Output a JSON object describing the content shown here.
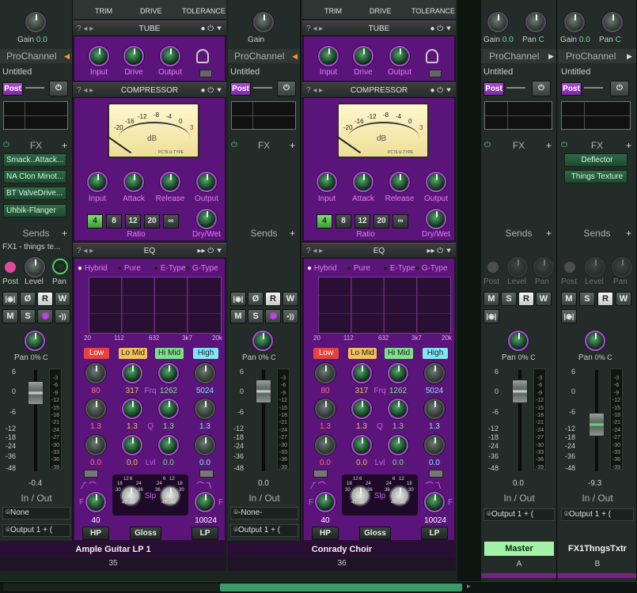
{
  "strip1": {
    "gain_label": "Gain",
    "gain_value": "0.0",
    "prochannel_label": "ProChannel",
    "preset": "Untitled",
    "post_label": "Post",
    "fx_label": "FX",
    "fx_slots": [
      "Smack..Attack...",
      "NA Clon Minot...",
      "BT ValveDrive...",
      "Uhbik-Flanger"
    ],
    "sends_label": "Sends",
    "send_name": "FX1 - things te...",
    "send_post": "Post",
    "send_level": "Level",
    "send_pan": "Pan",
    "pan_label": "Pan",
    "pan_value": "0% C",
    "scale": [
      "6",
      "0",
      "-6",
      "-12",
      "-18",
      "-24",
      "-36",
      "-48"
    ],
    "meter_scale": [
      "-3",
      "-6",
      "-9",
      "-12",
      "-15",
      "-18",
      "-21",
      "-24",
      "-27",
      "-30",
      "-33",
      "-36",
      "-39"
    ],
    "volume": "-0.4",
    "inout_label": "In / Out",
    "input": "None",
    "output": "Output 1 + (",
    "name": "Ample Guitar LP 1",
    "number": "35"
  },
  "pc1": {
    "top_labels": [
      "TRIM",
      "DRIVE",
      "TOLERANCE"
    ],
    "tube_title": "TUBE",
    "tube_knobs": [
      "Input",
      "Drive",
      "Output"
    ],
    "comp_title": "COMPRESSOR",
    "vu_unit": "dB",
    "vu_brand": "PC76 U-TYPE",
    "vu_scale": [
      "-20",
      "-16",
      "-12",
      "-8",
      "-4",
      "0",
      "3"
    ],
    "comp_knobs": [
      "Input",
      "Attack",
      "Release",
      "Output"
    ],
    "ratios": [
      "4",
      "8",
      "12",
      "20",
      "∞"
    ],
    "ratio_label": "Ratio",
    "drywet_label": "Dry/Wet",
    "eq_title": "EQ",
    "eq_modes": [
      "Hybrid",
      "Pure",
      "E-Type",
      "G-Type"
    ],
    "eq_freqs": [
      "20",
      "112",
      "632",
      "3k7",
      "20k"
    ],
    "bands": [
      "Low",
      "Lo Mid",
      "Hi Mid",
      "High"
    ],
    "freq_values": [
      "80",
      "317",
      "1262",
      "5024"
    ],
    "freq_label": "Frq",
    "q_values": [
      "1.3",
      "1.3",
      "1.3",
      "1.3"
    ],
    "q_label": "Q",
    "lvl_values": [
      "0.0",
      "0.0",
      "0.0",
      "0.0"
    ],
    "lvl_label": "Lvl",
    "slp_label": "Slp",
    "slp_scale": [
      "12",
      "6",
      "6",
      "12",
      "18",
      "24",
      "24",
      "18",
      "30",
      "36",
      "36",
      "30",
      "42",
      "48",
      "48",
      "42"
    ],
    "hp_value": "40",
    "lp_value": "10024",
    "f_label": "F",
    "hp_label": "HP",
    "gloss_label": "Gloss",
    "lp_label": "LP"
  },
  "strip2": {
    "gain_label": "Gain",
    "prochannel_label": "ProChannel",
    "preset": "Untitled",
    "post_label": "Post",
    "fx_label": "FX",
    "sends_label": "Sends",
    "pan_label": "Pan",
    "pan_value": "0% C",
    "volume": "0.0",
    "inout_label": "In / Out",
    "input": "-None-",
    "output": "Output 1 + (",
    "name": "Conrady Choir",
    "number": "36"
  },
  "strip3": {
    "gain_label": "Gain",
    "gain_value": "0.0",
    "pan_top": "Pan",
    "pan_top_value": "C",
    "prochannel_label": "ProChannel",
    "preset": "Untitled",
    "post_label": "Post",
    "fx_label": "FX",
    "sends_label": "Sends",
    "send_post": "Post",
    "send_level": "Level",
    "send_pan": "Pan",
    "pan_label": "Pan",
    "pan_value": "0% C",
    "volume": "0.0",
    "inout_label": "In / Out",
    "output": "Output 1 + (",
    "name": "Master",
    "number": "A"
  },
  "strip4": {
    "gain_label": "Gain",
    "gain_value": "0.0",
    "pan_top": "Pan",
    "pan_top_value": "C",
    "prochannel_label": "ProChannel",
    "preset": "Untitled",
    "post_label": "Post",
    "fx_label": "FX",
    "fx_slots": [
      "Deflector",
      "Things Texture"
    ],
    "sends_label": "Sends",
    "send_post": "Post",
    "send_level": "Level",
    "send_pan": "Pan",
    "pan_label": "Pan",
    "pan_value": "0% C",
    "volume": "-9.3",
    "inout_label": "In / Out",
    "output": "Output 1 + (",
    "name": "FX1ThngsTxtr",
    "number": "B"
  },
  "buttons": {
    "m": "M",
    "s": "S",
    "r": "R",
    "w": "W"
  },
  "colors": {
    "accent": "#b14ad8",
    "panel": "#5b157a",
    "knob": "#1f5a32",
    "low": "#e8423c",
    "lomid": "#f2c05a",
    "himid": "#7de08a",
    "high": "#7ee8f4"
  }
}
